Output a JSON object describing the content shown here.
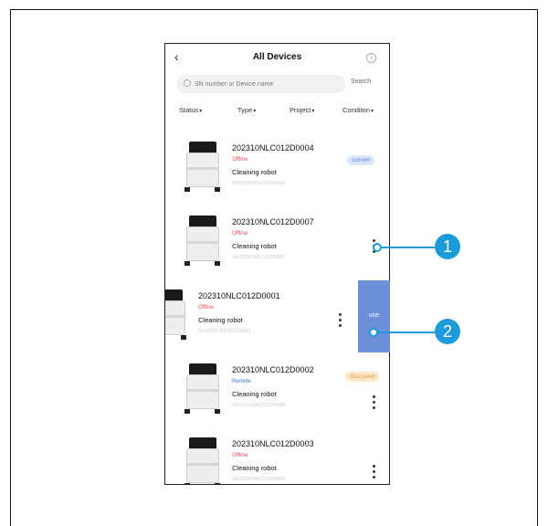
{
  "header": {
    "back_glyph": "‹",
    "title": "All Devices",
    "info_glyph": "i"
  },
  "search": {
    "placeholder": "SN number or Device name",
    "button_label": "Search"
  },
  "filters": [
    "Status",
    "Type",
    "Project",
    "Conditon"
  ],
  "devices": [
    {
      "sn": "202310NLC012D0004",
      "status": "Offline",
      "status_color": "#e05050",
      "type": "Cleaning robot",
      "sub": "SN:202310NLC012D0004",
      "badge": "current",
      "badge_color": "#5b86d6",
      "badge_bg": "#dbe6fa"
    },
    {
      "sn": "202310NLC012D0007",
      "status": "Offline",
      "status_color": "#e05050",
      "type": "Cleaning robot",
      "sub": "SN:202310NLC012D0007"
    },
    {
      "sn": "202310NLC012D0001",
      "status": "Offline",
      "status_color": "#e05050",
      "type": "Cleaning robot",
      "sub": "SN:202310NLC012D0001"
    },
    {
      "sn": "202310NLC012D0002",
      "status": "Remote",
      "status_color": "#3d6fd0",
      "type": "Cleaning robot",
      "sub": "SN:202310NLC012D0002",
      "badge": "Occupied",
      "badge_color": "#e39a3a",
      "badge_bg": "#fde8c8"
    },
    {
      "sn": "202310NLC012D0003",
      "status": "Offline",
      "status_color": "#e05050",
      "type": "Cleaning robot",
      "sub": "SN:202310NLC012D0003"
    }
  ],
  "swipe_action": {
    "label": "use"
  },
  "callouts": {
    "one": "1",
    "two": "2",
    "color": "#1d9bd8"
  }
}
